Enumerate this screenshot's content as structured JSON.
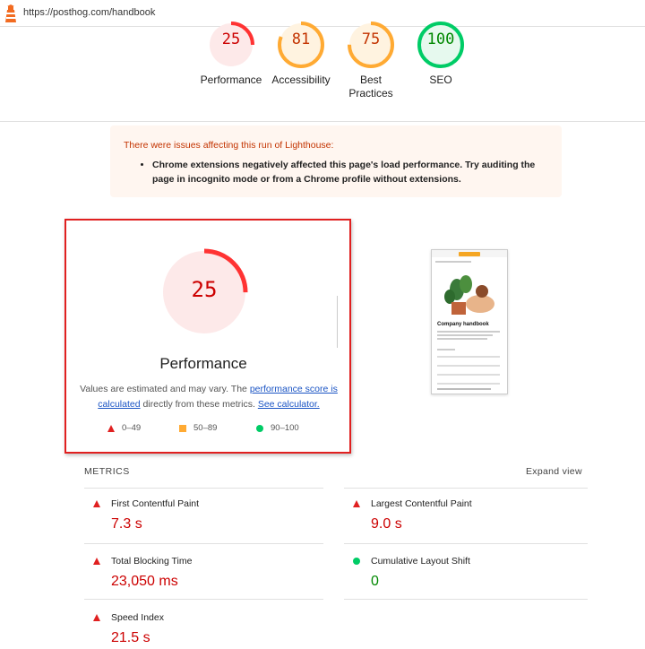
{
  "browser": {
    "url": "https://posthog.com/handbook"
  },
  "categories": [
    {
      "label": "Performance",
      "score": "25",
      "value": 25,
      "color": "#ff3333",
      "textcolor": "#c00",
      "bg": "#fde9e9"
    },
    {
      "label": "Accessibility",
      "score": "81",
      "value": 81,
      "color": "#ffaa33",
      "textcolor": "#c33300",
      "bg": "#fff3e0"
    },
    {
      "label": "Best Practices",
      "score": "75",
      "value": 75,
      "color": "#ffaa33",
      "textcolor": "#c33300",
      "bg": "#fff3e0"
    },
    {
      "label": "SEO",
      "score": "100",
      "value": 100,
      "color": "#00cc66",
      "textcolor": "#080",
      "bg": "#e6f9ee"
    }
  ],
  "warning": {
    "title": "There were issues affecting this run of Lighthouse:",
    "item": "Chrome extensions negatively affected this page's load performance. Try auditing the page in incognito mode or from a Chrome profile without extensions."
  },
  "performance": {
    "score": "25",
    "value": 25,
    "title": "Performance",
    "desc_prefix": "Values are estimated and may vary. The ",
    "link1": "performance score is calculated",
    "desc_mid": " directly from these metrics. ",
    "link2": "See calculator.",
    "legend": [
      {
        "icon": "fail-triangle-icon",
        "range": "0–49"
      },
      {
        "icon": "average-square-icon",
        "range": "50–89"
      },
      {
        "icon": "pass-circle-icon",
        "range": "90–100"
      }
    ]
  },
  "thumbnail": {
    "heading": "Company handbook"
  },
  "metrics": {
    "heading": "METRICS",
    "expand": "Expand view",
    "items": [
      {
        "label": "First Contentful Paint",
        "value": "7.3 s",
        "status": "fail"
      },
      {
        "label": "Largest Contentful Paint",
        "value": "9.0 s",
        "status": "fail"
      },
      {
        "label": "Total Blocking Time",
        "value": "23,050 ms",
        "status": "fail"
      },
      {
        "label": "Cumulative Layout Shift",
        "value": "0",
        "status": "pass"
      },
      {
        "label": "Speed Index",
        "value": "21.5 s",
        "status": "fail"
      }
    ]
  }
}
